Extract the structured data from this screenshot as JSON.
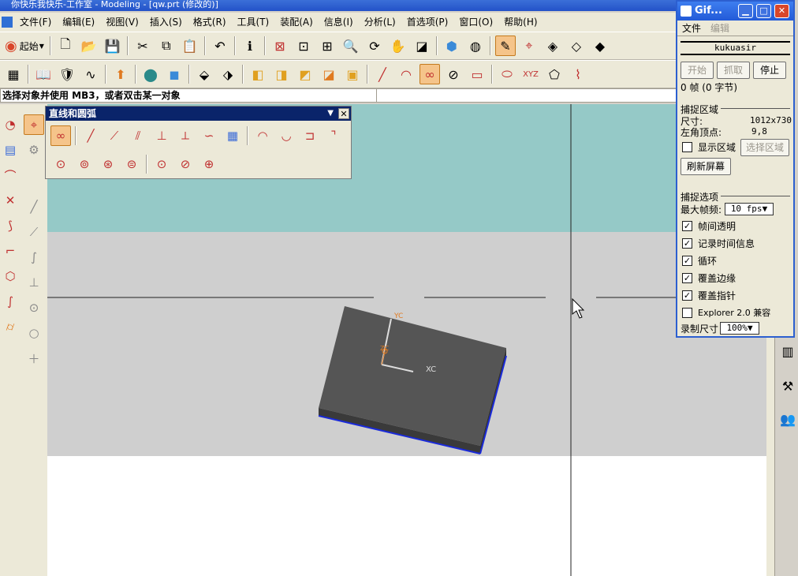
{
  "app": {
    "title": "你快乐我快乐-工作室 - Modeling - [qw.prt (修改的)]"
  },
  "menu": [
    "文件(F)",
    "编辑(E)",
    "视图(V)",
    "插入(S)",
    "格式(R)",
    "工具(T)",
    "装配(A)",
    "信息(I)",
    "分析(L)",
    "首选项(P)",
    "窗口(O)",
    "帮助(H)"
  ],
  "toolbar": {
    "start_label": "起始"
  },
  "status": {
    "prompt": "选择对象并使用 MB3，或者双击某一对象"
  },
  "float_panel": {
    "title": "直线和圆弧"
  },
  "viewport": {
    "labels": {
      "xc": "XC",
      "yc": "YC",
      "zc": "ZC"
    }
  },
  "gif": {
    "title": "Gif...",
    "menu_file": "文件",
    "menu_edit": "编辑",
    "user": "kukuasir",
    "btn_start": "开始",
    "btn_capture": "抓取",
    "btn_stop": "停止",
    "frames": "0 帧 (0 字节)",
    "capture_area_header": "捕捉区域",
    "size_label": "尺寸:",
    "size_value": "1012x730",
    "corner_label": "左角顶点:",
    "corner_value": "9,8",
    "show_area_label": "显示区域",
    "select_area_btn": "选择区域",
    "refresh_btn": "刷新屏幕",
    "capture_options_header": "捕捉选项",
    "max_fps_label": "最大帧频:",
    "max_fps_value": "10 fps",
    "options": [
      {
        "label": "帧间透明",
        "checked": "✓"
      },
      {
        "label": "记录时间信息",
        "checked": "✓"
      },
      {
        "label": "循环",
        "checked": "✓"
      },
      {
        "label": "覆盖边缘",
        "checked": "✓"
      },
      {
        "label": "覆盖指针",
        "checked": "✓"
      }
    ],
    "explorer_label": "Explorer 2.0 兼容",
    "record_size_label": "录制尺寸",
    "record_size_value": "100%"
  }
}
